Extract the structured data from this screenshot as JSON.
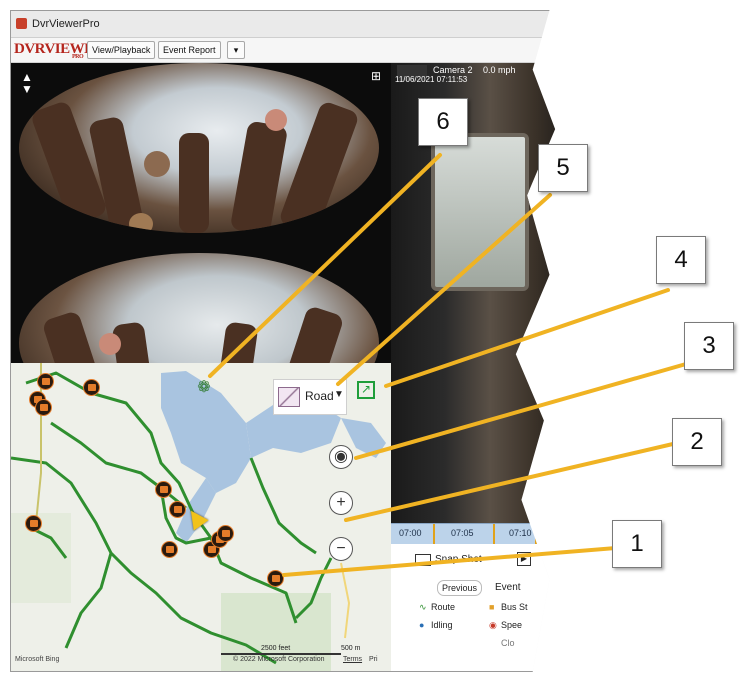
{
  "window": {
    "title": "DvrViewerPro"
  },
  "toolbar": {
    "logo_main": "DVRVIEWER",
    "logo_sub": "PRO",
    "view_playback": "View/Playback",
    "event_report": "Event Report"
  },
  "camera2": {
    "label": "Camera 2",
    "speed": "0.0 mph",
    "timestamp": "11/06/2021 07:11:53"
  },
  "map": {
    "layer_select": "Road",
    "scale_feet": "2500 feet",
    "scale_meters": "500 m",
    "copyright": "© 2022 Microsoft Corporation",
    "terms": "Terms",
    "privacy": "Pri",
    "brand": "Microsoft Bing"
  },
  "timeline": {
    "ticks": [
      "07:00",
      "07:05",
      "07:10"
    ]
  },
  "side_panel": {
    "snapshot": "Snap Shot",
    "previous": "Previous",
    "events": "Event",
    "legend": [
      {
        "label": "Route",
        "icon": "route-icon"
      },
      {
        "label": "Bus St",
        "icon": "bus-stop-icon"
      },
      {
        "label": "Idling",
        "icon": "idling-icon"
      },
      {
        "label": "Spee",
        "icon": "speed-icon"
      }
    ],
    "clock": "Clo"
  },
  "callouts": [
    "1",
    "2",
    "3",
    "4",
    "5",
    "6"
  ],
  "colors": {
    "callout_line": "#f0b323",
    "route": "#2f8f2f",
    "accent_logo": "#b5261e",
    "water": "#a9c4e0"
  }
}
